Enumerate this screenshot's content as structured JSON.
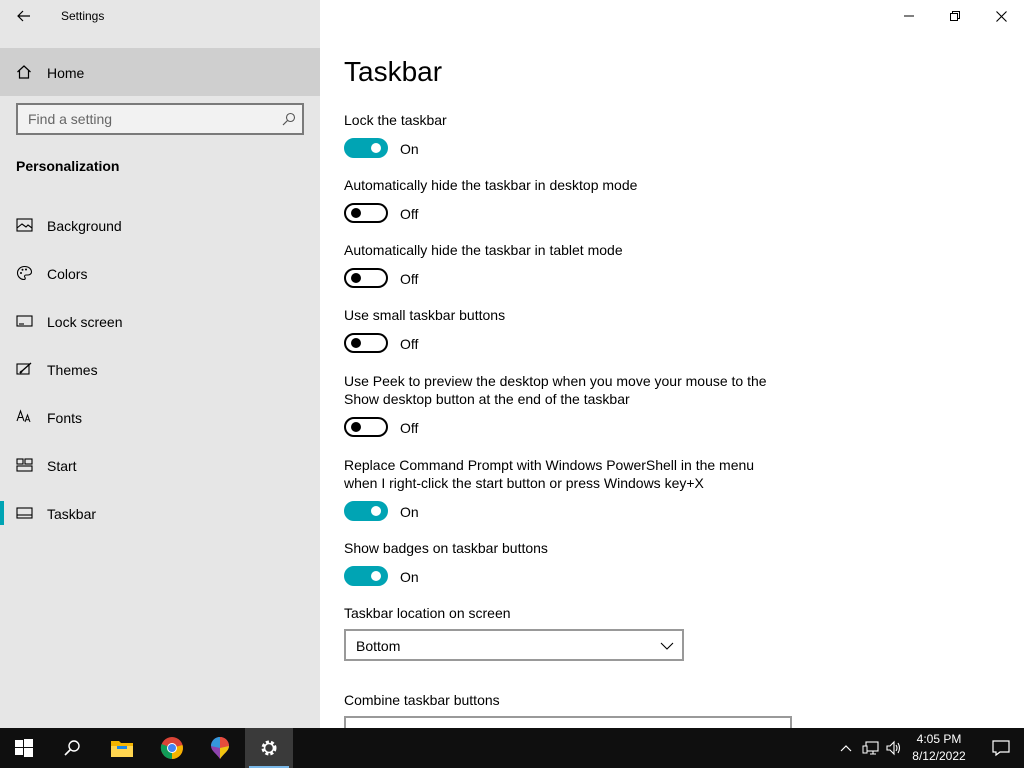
{
  "window": {
    "title": "Settings"
  },
  "sidebar": {
    "home_label": "Home",
    "search_placeholder": "Find a setting",
    "section_title": "Personalization",
    "items": [
      {
        "label": "Background",
        "icon": "picture-icon"
      },
      {
        "label": "Colors",
        "icon": "palette-icon"
      },
      {
        "label": "Lock screen",
        "icon": "lock-screen-icon"
      },
      {
        "label": "Themes",
        "icon": "themes-brush-icon"
      },
      {
        "label": "Fonts",
        "icon": "fonts-icon"
      },
      {
        "label": "Start",
        "icon": "start-tiles-icon"
      },
      {
        "label": "Taskbar",
        "icon": "taskbar-icon",
        "active": true
      }
    ]
  },
  "main": {
    "title": "Taskbar",
    "settings": [
      {
        "label": "Lock the taskbar",
        "state": "On"
      },
      {
        "label": "Automatically hide the taskbar in desktop mode",
        "state": "Off"
      },
      {
        "label": "Automatically hide the taskbar in tablet mode",
        "state": "Off"
      },
      {
        "label": "Use small taskbar buttons",
        "state": "Off"
      },
      {
        "label": "Use Peek to preview the desktop when you move your mouse to the Show desktop button at the end of the taskbar",
        "state": "Off"
      },
      {
        "label": "Replace Command Prompt with Windows PowerShell in the menu when I right-click the start button or press Windows key+X",
        "state": "On"
      },
      {
        "label": "Show badges on taskbar buttons",
        "state": "On"
      }
    ],
    "location_label": "Taskbar location on screen",
    "location_value": "Bottom",
    "combine_label": "Combine taskbar buttons"
  },
  "taskbar": {
    "apps": [
      "start-icon",
      "search-icon",
      "file-explorer-icon",
      "chrome-icon",
      "paint3d-icon",
      "settings-gear-icon"
    ],
    "time": "4:05 PM",
    "date": "8/12/2022"
  },
  "colors": {
    "accent": "#00a4b4",
    "sidebar_bg": "#e6e6e6",
    "taskbar_bg": "#0f0f0f"
  }
}
